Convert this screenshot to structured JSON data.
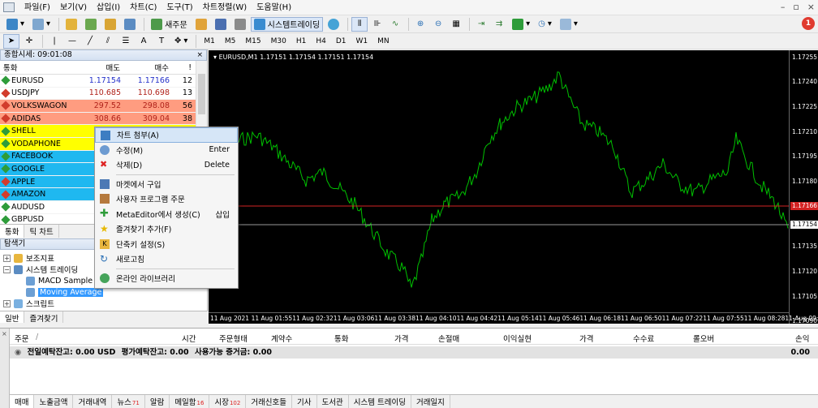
{
  "menu": [
    "파일(F)",
    "보기(V)",
    "삽입(I)",
    "차트(C)",
    "도구(T)",
    "차트정렬(W)",
    "도움말(H)"
  ],
  "toolbar1": {
    "new_order": "새주문",
    "algo_trading": "시스템트레이딩"
  },
  "notification_count": "1",
  "timeframes": [
    "M1",
    "M5",
    "M15",
    "M30",
    "H1",
    "H4",
    "D1",
    "W1",
    "MN"
  ],
  "market_watch": {
    "title": "종합시세: 09:01:08",
    "headers": {
      "symbol": "통화",
      "bid": "매도",
      "ask": "매수",
      "spread": "!"
    },
    "rows": [
      {
        "symbol": "EURUSD",
        "bid": "1.17154",
        "ask": "1.17166",
        "spread": "12",
        "dir": "up",
        "bg": "#ffffff"
      },
      {
        "symbol": "USDJPY",
        "bid": "110.685",
        "ask": "110.698",
        "spread": "13",
        "dir": "dn",
        "bg": "#ffffff"
      },
      {
        "symbol": "VOLKSWAGON",
        "bid": "297.52",
        "ask": "298.08",
        "spread": "56",
        "dir": "dn",
        "bg": "#ff9c80"
      },
      {
        "symbol": "ADIDAS",
        "bid": "308.66",
        "ask": "309.04",
        "spread": "38",
        "dir": "dn",
        "bg": "#ff9c80"
      },
      {
        "symbol": "SHELL",
        "bid": "",
        "ask": "",
        "spread": "",
        "dir": "up",
        "bg": "#ffff00"
      },
      {
        "symbol": "VODAPHONE",
        "bid": "",
        "ask": "",
        "spread": "",
        "dir": "up",
        "bg": "#ffff00"
      },
      {
        "symbol": "FACEBOOK",
        "bid": "",
        "ask": "",
        "spread": "",
        "dir": "up",
        "bg": "#1fb8f0"
      },
      {
        "symbol": "GOOGLE",
        "bid": "2",
        "ask": "",
        "spread": "",
        "dir": "up",
        "bg": "#1fb8f0"
      },
      {
        "symbol": "APPLE",
        "bid": "",
        "ask": "",
        "spread": "",
        "dir": "dn",
        "bg": "#1fb8f0"
      },
      {
        "symbol": "AMAZON",
        "bid": "3",
        "ask": "",
        "spread": "",
        "dir": "dn",
        "bg": "#1fb8f0"
      },
      {
        "symbol": "AUDUSD",
        "bid": "0",
        "ask": "",
        "spread": "",
        "dir": "up",
        "bg": "#ffffff"
      },
      {
        "symbol": "GBPUSD",
        "bid": "",
        "ask": "",
        "spread": "",
        "dir": "up",
        "bg": "#ffffff"
      }
    ],
    "tabs": [
      "통화",
      "틱 차트"
    ]
  },
  "navigator": {
    "title": "탐색기",
    "items": [
      "보조지표",
      "시스템 트레이딩",
      "MACD Sample",
      "Moving Average",
      "스크립트"
    ],
    "tabs": [
      "일반",
      "즐겨찾기"
    ]
  },
  "chart": {
    "title": "EURUSD,M1  1.17151 1.17154 1.17151 1.17154",
    "price_labels": [
      "1.17255",
      "1.17240",
      "1.17225",
      "1.17210",
      "1.17195",
      "1.17180",
      "1.17166",
      "1.17154",
      "1.17135",
      "1.17120",
      "1.17105",
      "1.17090"
    ],
    "bid_tag": "1.17166",
    "ask_tag": "1.17154",
    "time_labels": [
      "11 Aug 2021",
      "11 Aug 01:55",
      "11 Aug 02:32",
      "11 Aug 03:06",
      "11 Aug 03:38",
      "11 Aug 04:10",
      "11 Aug 04:42",
      "11 Aug 05:14",
      "11 Aug 05:46",
      "11 Aug 06:18",
      "11 Aug 06:50",
      "11 Aug 07:22",
      "11 Aug 07:55",
      "11 Aug 08:28",
      "11 Aug 09:00"
    ],
    "colors": {
      "bg": "#000000",
      "line": "#00c000",
      "bid_line": "#d42323"
    }
  },
  "context_menu": {
    "items": [
      {
        "label": "차트 첨부(A)",
        "shortcut": ""
      },
      {
        "label": "수정(M)",
        "shortcut": "Enter"
      },
      {
        "label": "삭제(D)",
        "shortcut": "Delete"
      },
      {
        "label": "마켓에서 구입",
        "shortcut": ""
      },
      {
        "label": "사용자 프로그램 주문",
        "shortcut": ""
      },
      {
        "label": "MetaEditor에서 생성(C)",
        "shortcut": "삽입"
      },
      {
        "label": "즐겨찾기 추가(F)",
        "shortcut": ""
      },
      {
        "label": "단축키 설정(S)",
        "shortcut": ""
      },
      {
        "label": "새로고침",
        "shortcut": ""
      },
      {
        "label": "온라인 라이브러리",
        "shortcut": ""
      }
    ]
  },
  "terminal": {
    "headers": [
      "주문",
      "/",
      "시간",
      "주문형태",
      "계약수",
      "통화",
      "가격",
      "손절매",
      "이익실현",
      "가격",
      "수수료",
      "롤오버",
      "손익"
    ],
    "balance_labels": [
      "전일예탁잔고: 0.00 USD",
      "평가예탁잔고: 0.00",
      "사용가능 증거금: 0.00"
    ],
    "balance_value": "0.00",
    "tabs": [
      {
        "label": "매매",
        "badge": ""
      },
      {
        "label": "노출금액",
        "badge": ""
      },
      {
        "label": "거래내역",
        "badge": ""
      },
      {
        "label": "뉴스",
        "badge": "71"
      },
      {
        "label": "알람",
        "badge": ""
      },
      {
        "label": "메일함",
        "badge": "16"
      },
      {
        "label": "시장",
        "badge": "102"
      },
      {
        "label": "거래신호들",
        "badge": ""
      },
      {
        "label": "기사",
        "badge": ""
      },
      {
        "label": "도서관",
        "badge": ""
      },
      {
        "label": "시스템 트레이딩",
        "badge": ""
      },
      {
        "label": "거래일지",
        "badge": ""
      }
    ]
  }
}
